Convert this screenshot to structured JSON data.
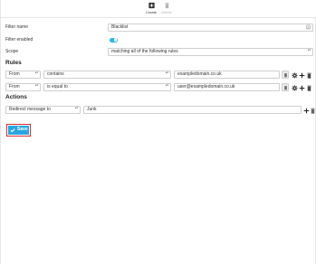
{
  "toolbar": {
    "create_label": "Create",
    "delete_label": "Delete"
  },
  "form": {
    "filter_name_label": "Filter name",
    "filter_name_value": "Blacklist",
    "filter_enabled_label": "Filter enabled",
    "filter_enabled": true,
    "scope_label": "Scope",
    "scope_value": "matching all of the following rules"
  },
  "rules": {
    "heading": "Rules",
    "items": [
      {
        "field": "From",
        "operator": "contains",
        "value": "exampledomain.co.uk"
      },
      {
        "field": "From",
        "operator": "is equal to",
        "value": "user@exampledomain.co.uk"
      }
    ]
  },
  "actions": {
    "heading": "Actions",
    "items": [
      {
        "action": "Redirect message to",
        "value": "Junk"
      }
    ]
  },
  "save_label": "Save",
  "colors": {
    "accent": "#29a6e0",
    "highlight": "#d32f2f",
    "toggle_on": "#29b6e6"
  }
}
